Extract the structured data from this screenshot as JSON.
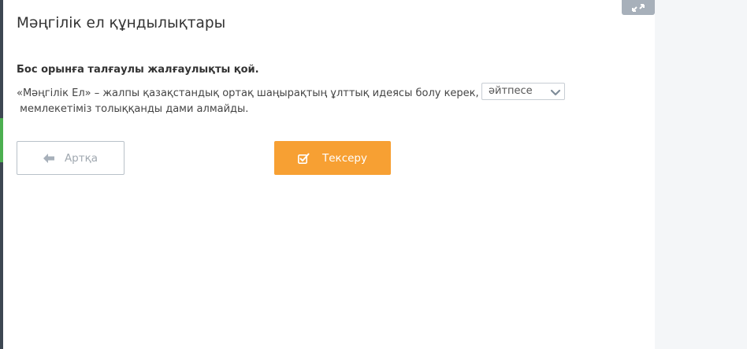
{
  "page": {
    "title": "Мәңгілік ел құндылықтары"
  },
  "question": {
    "instruction": "Бос орынға талғаулы жалғаулықты қой.",
    "sentence_part1": "«Мәңгілік Ел» – жалпы қазақстандық ортақ шаңырақтың ұлттық идеясы болу керек,",
    "sentence_part2": " мемлекетіміз толыққанды дами алмайды.",
    "selected_option": "әйтпесе"
  },
  "buttons": {
    "back_label": "Артқа",
    "check_label": "Тексеру"
  },
  "colors": {
    "accent_orange": "#f7a033",
    "sidebar_dark": "#3d4752",
    "sidebar_green": "#4caf50"
  },
  "icons": {
    "back": "arrow-left-icon",
    "check": "checkbox-check-icon",
    "dropdown": "chevron-down-icon",
    "corner": "expand-icon"
  }
}
